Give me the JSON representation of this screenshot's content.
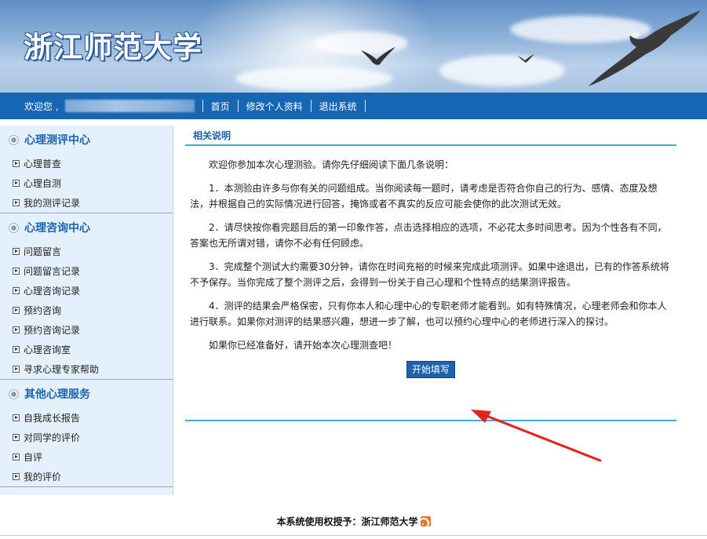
{
  "banner": {
    "title": "浙江师范大学"
  },
  "navbar": {
    "welcome": "欢迎您 ,",
    "links": [
      "首页",
      "修改个人资料",
      "退出系统"
    ]
  },
  "sidebar": {
    "sections": [
      {
        "title": "心理测评中心",
        "items": [
          "心理普查",
          "心理自测",
          "我的测评记录"
        ]
      },
      {
        "title": "心理咨询中心",
        "items": [
          "问题留言",
          "问题留言记录",
          "心理咨询记录",
          "预约咨询",
          "预约咨询记录",
          "心理咨询室",
          "寻求心理专家帮助"
        ]
      },
      {
        "title": "其他心理服务",
        "items": [
          "自我成长报告",
          "对同学的评价",
          "自评",
          "我的评价"
        ]
      }
    ]
  },
  "main": {
    "heading": "相关说明",
    "intro": "欢迎你参加本次心理测验。请你先仔细阅读下面几条说明：",
    "paragraphs": [
      "1．本测验由许多与你有关的问题组成。当你阅读每一题时，请考虑是否符合你自己的行为、感情、态度及想法，并根据自己的实际情况进行回答，掩饰或者不真实的反应可能会使你的此次测试无效。",
      "2．请尽快按你看完题目后的第一印象作答，点击选择相应的选项，不必花太多时间思考。因为个性各有不同，答案也无所谓对错，请你不必有任何顾虑。",
      "3．完成整个测试大约需要30分钟，请你在时间充裕的时候来完成此项测评。如果中途退出，已有的作答系统将不予保存。当你完成了整个测评之后，会得到一份关于自己心理和个性特点的结果测评报告。",
      "4．测评的结果会严格保密，只有你本人和心理中心的专职老师才能看到。如有特殊情况，心理老师会和你本人进行联系。如果你对测评的结果感兴趣，想进一步了解，也可以预约心理中心的老师进行深入的探讨。"
    ],
    "closing": "如果你已经准备好，请开始本次心理测查吧！",
    "start_button": "开始填写"
  },
  "footer": {
    "text": "本系统使用权授予：浙江师范大学"
  },
  "colors": {
    "nav": "#1666b3",
    "accent_line": "#3aaee3",
    "title_blue": "#1b63b0",
    "button": "#1e62ad",
    "annotation_arrow": "#e8211e"
  },
  "icons": {
    "section": "radio-icon",
    "menu": "arrow-icon",
    "footer": "rss-icon"
  }
}
